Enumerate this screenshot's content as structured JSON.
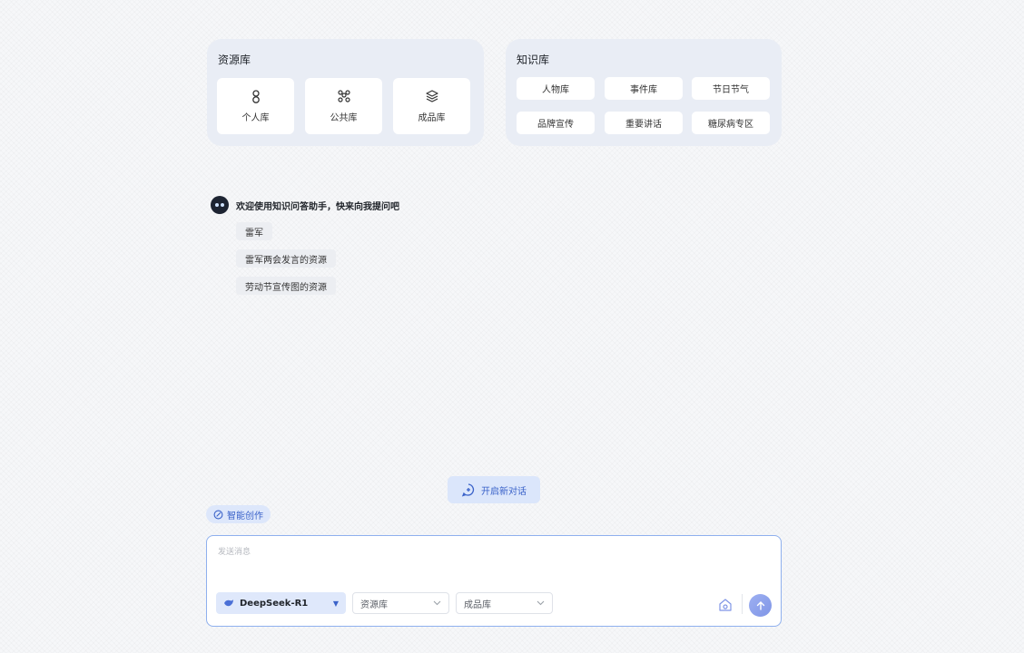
{
  "resource_panel": {
    "title": "资源库",
    "cards": [
      {
        "label": "个人库",
        "icon": "person-icon"
      },
      {
        "label": "公共库",
        "icon": "group-icon"
      },
      {
        "label": "成品库",
        "icon": "layers-icon"
      }
    ]
  },
  "knowledge_panel": {
    "title": "知识库",
    "items": [
      "人物库",
      "事件库",
      "节日节气",
      "品牌宣传",
      "重要讲话",
      "糖尿病专区"
    ]
  },
  "chat": {
    "welcome": "欢迎使用知识问答助手，快来向我提问吧",
    "suggestions": [
      "雷军",
      "雷军两会发言的资源",
      "劳动节宣传图的资源"
    ]
  },
  "new_chat_label": "开启新对话",
  "smart_create_label": "智能创作",
  "composer": {
    "placeholder": "发送消息",
    "model": "DeepSeek-R1",
    "resource_select": "资源库",
    "product_select": "成品库"
  },
  "colors": {
    "accent": "#3a62c9",
    "panel_bg": "#e9edf5",
    "send_button": "#8fa3ec"
  }
}
